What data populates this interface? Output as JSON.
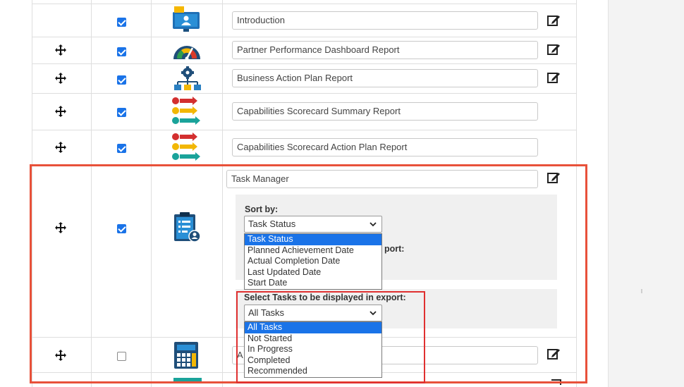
{
  "rows": [
    {
      "title": "Introduction",
      "checked": true,
      "icon": "monitor-user-icon",
      "draggable": false,
      "editable": true
    },
    {
      "title": "Partner Performance Dashboard Report",
      "checked": true,
      "icon": "gauge-icon",
      "draggable": true,
      "editable": true
    },
    {
      "title": "Business Action Plan Report",
      "checked": true,
      "icon": "gear-org-chart-icon",
      "draggable": true,
      "editable": true
    },
    {
      "title": "Capabilities Scorecard Summary Report",
      "checked": true,
      "icon": "numbered-arrows-icon",
      "draggable": true,
      "editable": false
    },
    {
      "title": "Capabilities Scorecard Action Plan Report",
      "checked": true,
      "icon": "numbered-arrows-icon",
      "draggable": true,
      "editable": false
    }
  ],
  "task_manager": {
    "title": "Task Manager",
    "checked": true,
    "icon": "clipboard-user-icon",
    "sort_by": {
      "label": "Sort by:",
      "selected": "Task Status",
      "options": [
        "Task Status",
        "Planned Achievement Date",
        "Actual Completion Date",
        "Last Updated Date",
        "Start Date"
      ],
      "hidden_label_fragment": "port:"
    },
    "select_tasks": {
      "label": "Select Tasks to be displayed in export:",
      "selected": "All Tasks",
      "options": [
        "All Tasks",
        "Not Started",
        "In Progress",
        "Completed",
        "Recommended"
      ]
    }
  },
  "next_row": {
    "checked": false,
    "icon": "calculator-icon",
    "title_fragment": "A"
  },
  "colors": {
    "accent": "#1a73e8",
    "highlight_outer": "#e8513a",
    "highlight_inner": "#e03030"
  }
}
